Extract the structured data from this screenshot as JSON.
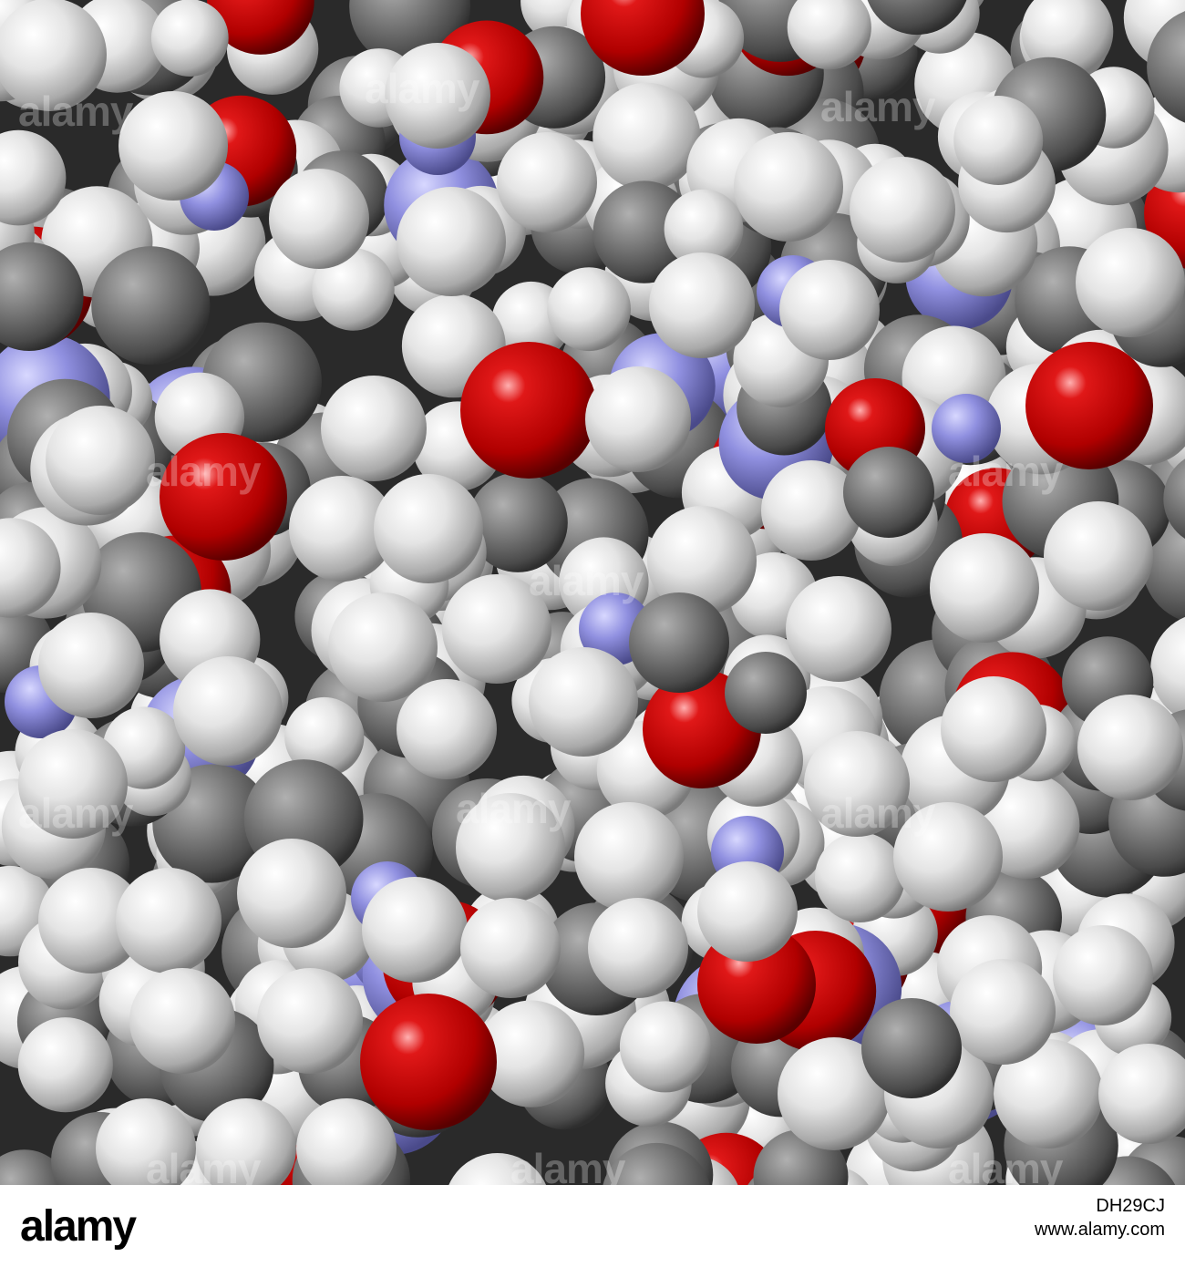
{
  "image": {
    "subject": "space-filling molecular model",
    "atom_colors": {
      "hydrogen": "#e8e8e8",
      "carbon": "#6e6e6e",
      "oxygen": "#cc0000",
      "nitrogen": "#8a8ae6"
    },
    "watermark_text": "alamy"
  },
  "footer": {
    "logo": "alamy",
    "image_id": "DH29CJ",
    "url": "www.alamy.com"
  }
}
